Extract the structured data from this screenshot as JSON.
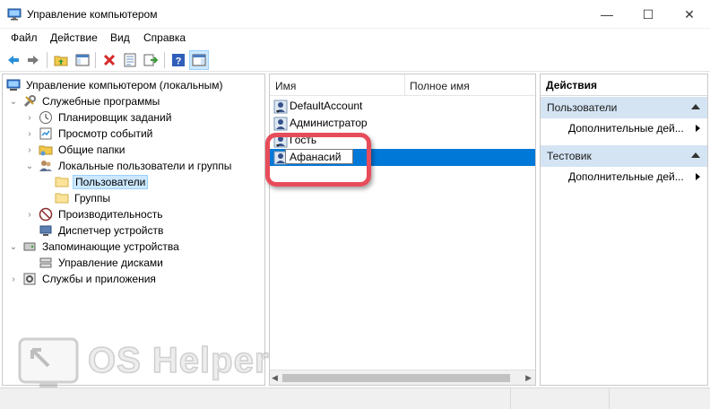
{
  "window": {
    "title": "Управление компьютером",
    "controls": {
      "minimize": "—",
      "maximize": "☐",
      "close": "✕"
    }
  },
  "menu": [
    "Файл",
    "Действие",
    "Вид",
    "Справка"
  ],
  "toolbar": {
    "buttons": [
      "back-icon",
      "forward-icon",
      "up-folder-icon",
      "show-tree-icon",
      "delete-icon",
      "properties-icon",
      "export-icon",
      "help-icon",
      "action-pane-icon"
    ]
  },
  "tree": {
    "root": "Управление компьютером (локальным)",
    "items": [
      {
        "label": "Служебные программы",
        "icon": "tools-icon"
      },
      {
        "label": "Планировщик заданий",
        "icon": "clock-icon"
      },
      {
        "label": "Просмотр событий",
        "icon": "event-viewer-icon"
      },
      {
        "label": "Общие папки",
        "icon": "shared-folder-icon"
      },
      {
        "label": "Локальные пользователи и группы",
        "icon": "users-icon"
      },
      {
        "label": "Пользователи",
        "icon": "folder-icon"
      },
      {
        "label": "Группы",
        "icon": "folder-icon"
      },
      {
        "label": "Производительность",
        "icon": "performance-icon"
      },
      {
        "label": "Диспетчер устройств",
        "icon": "device-manager-icon"
      },
      {
        "label": "Запоминающие устройства",
        "icon": "storage-icon"
      },
      {
        "label": "Управление дисками",
        "icon": "disk-icon"
      },
      {
        "label": "Службы и приложения",
        "icon": "services-icon"
      }
    ]
  },
  "list": {
    "columns": [
      "Имя",
      "Полное имя"
    ],
    "rows": [
      {
        "name": "DefaultAccount",
        "icon": "user-disabled-icon"
      },
      {
        "name": "Администратор",
        "icon": "user-icon"
      },
      {
        "name": "Гость",
        "icon": "user-disabled-icon"
      },
      {
        "name": "",
        "icon": "user-icon"
      }
    ],
    "edit_value": "Афанасий"
  },
  "actions": {
    "title": "Действия",
    "sections": [
      {
        "label": "Пользователи",
        "item": "Дополнительные дей..."
      },
      {
        "label": "Тестовик",
        "item": "Дополнительные дей..."
      }
    ]
  },
  "watermark": {
    "text": "OS Helper"
  },
  "colors": {
    "selection": "#0078d7",
    "highlight": "#e74c5a",
    "section_bg": "#d4e4f3"
  }
}
